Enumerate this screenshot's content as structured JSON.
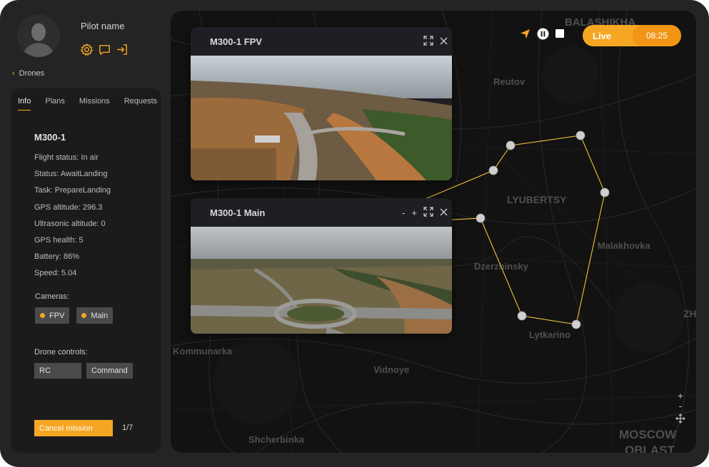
{
  "pilot": {
    "name": "Pilot name"
  },
  "nav": {
    "back_label": "Drones"
  },
  "tabs": [
    {
      "label": "Info",
      "active": true
    },
    {
      "label": "Plans",
      "active": false
    },
    {
      "label": "Missions",
      "active": false
    },
    {
      "label": "Requests",
      "active": false
    }
  ],
  "drone": {
    "name": "M300-1",
    "info": [
      "Flight status: In air",
      "Status: AwaitLanding",
      "Task: PrepareLanding",
      "GPS altitude: 296.3",
      "Ultrasonic altitude: 0",
      "GPS health: 5",
      "Battery: 86%",
      "Speed: 5.04"
    ]
  },
  "cameras": {
    "label": "Cameras:",
    "items": [
      "FPV",
      "Main"
    ]
  },
  "controls": {
    "label": "Drone controls:",
    "buttons": [
      "RC",
      "Command"
    ]
  },
  "mission": {
    "cancel_label": "Cancel mission",
    "progress": "1/7"
  },
  "live": {
    "label": "Live",
    "time": "08:25"
  },
  "zoom": {
    "in": "+",
    "out": "-"
  },
  "video_fpv": {
    "title": "M300-1  FPV"
  },
  "video_main": {
    "title": "M300-1 Main",
    "minus": "-",
    "plus": "+"
  },
  "map": {
    "places": [
      "BALASHIKHA",
      "Reutov",
      "LYUBERTSY",
      "Malakhovka",
      "Dzerzhinsky",
      "Lytkarino",
      "Kommunarka",
      "Vidnoye",
      "Shcherbinka",
      "MOSCOW",
      "OBLAST",
      "ZH"
    ]
  },
  "colors": {
    "accent": "#f5a623",
    "route": "#f0c23a",
    "background": "#242424"
  }
}
